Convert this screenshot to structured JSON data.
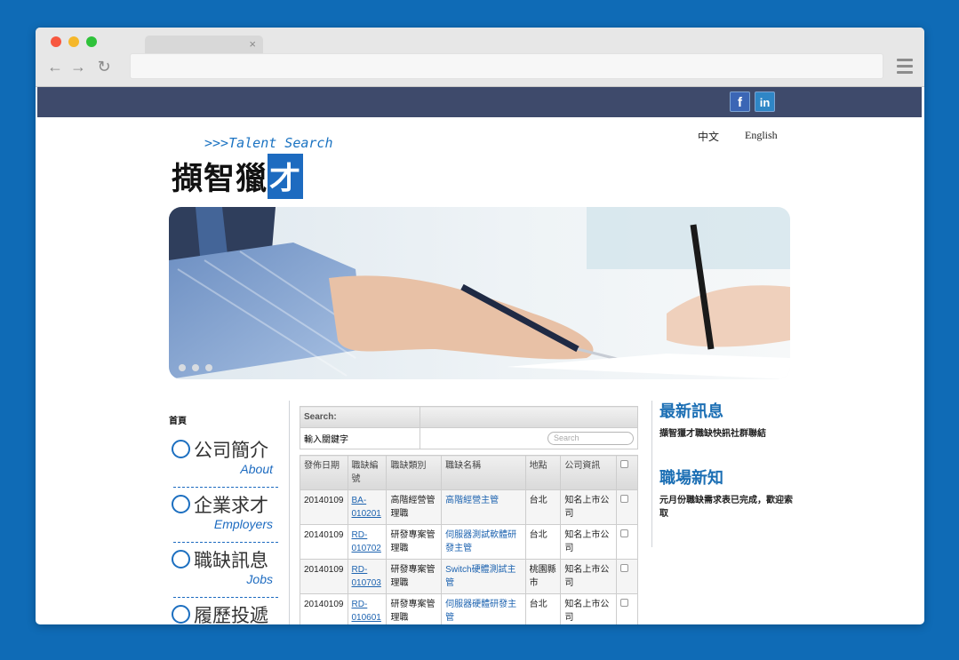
{
  "browser": {
    "tab_close": "×",
    "back_icon": "←",
    "forward_icon": "→",
    "reload_icon": "↻"
  },
  "header": {
    "social": {
      "facebook": "f",
      "linkedin": "in"
    },
    "lang": {
      "chinese": "中文",
      "english": "English"
    },
    "logo": {
      "en": ">>>Talent Search",
      "zh_main": "擷智獵",
      "zh_box": "才"
    }
  },
  "hero": {
    "slides": 3
  },
  "sidebar": {
    "home": "首頁",
    "items": [
      {
        "zh": "公司簡介",
        "en": "About"
      },
      {
        "zh": "企業求才",
        "en": "Employers"
      },
      {
        "zh": "職缺訊息",
        "en": "Jobs"
      },
      {
        "zh": "履歷投遞",
        "en": ""
      }
    ]
  },
  "search": {
    "label": "Search:",
    "keyword_label": "輸入關鍵字",
    "placeholder": "Search"
  },
  "jobs": {
    "headers": [
      "發佈日期",
      "職缺編號",
      "職缺類別",
      "職缺名稱",
      "地點",
      "公司資訊"
    ],
    "rows": [
      {
        "date": "20140109",
        "id_a": "BA-",
        "id_b": "010201",
        "cat": "高階經營管理職",
        "name": "高階經營主管",
        "loc": "台北",
        "company": "知名上市公司"
      },
      {
        "date": "20140109",
        "id_a": "RD-",
        "id_b": "010702",
        "cat": "研發專案管理職",
        "name": "伺服器測試軟體研發主管",
        "loc": "台北",
        "company": "知名上市公司"
      },
      {
        "date": "20140109",
        "id_a": "RD-",
        "id_b": "010703",
        "cat": "研發專案管理職",
        "name": "Switch硬體測試主管",
        "loc": "桃園縣市",
        "company": "知名上市公司"
      },
      {
        "date": "20140109",
        "id_a": "RD-",
        "id_b": "010601",
        "cat": "研發專案管理職",
        "name": "伺服器硬體研發主管",
        "loc": "台北",
        "company": "知名上市公司"
      }
    ]
  },
  "news": {
    "latest_title": "最新訊息",
    "latest_text": "擷智獵才職缺快訊社群聯結",
    "career_title": "職場新知",
    "career_text": "元月份職缺需求表已完成，歡迎索取"
  },
  "colors": {
    "background": "#0f6bb6",
    "topbar": "#3e4a6b",
    "accent": "#1c6fb4"
  }
}
